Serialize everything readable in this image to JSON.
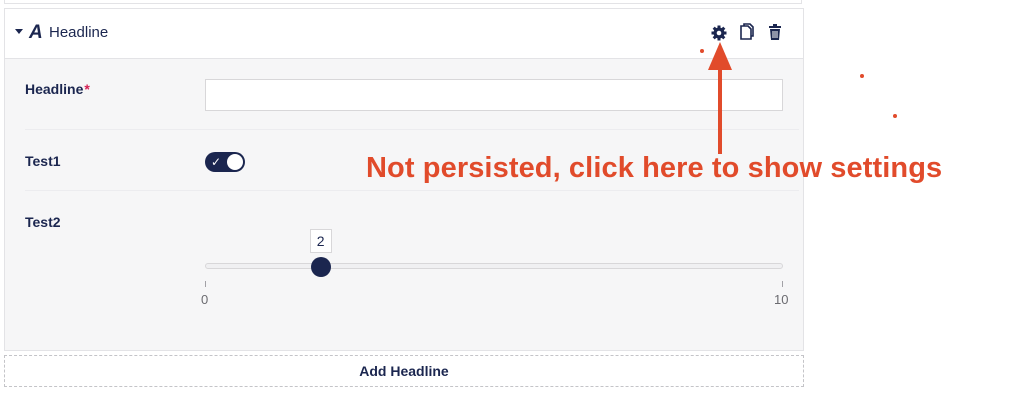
{
  "block": {
    "type_icon": "A",
    "title": "Headline",
    "actions": [
      {
        "name": "settings",
        "icon": "gear-icon"
      },
      {
        "name": "duplicate",
        "icon": "copy-icon"
      },
      {
        "name": "delete",
        "icon": "trash-icon"
      }
    ]
  },
  "fields": {
    "headline": {
      "label": "Headline",
      "required_mark": "*",
      "value": "",
      "placeholder": ""
    },
    "test1": {
      "label": "Test1",
      "checked": true,
      "check_glyph": "✓"
    },
    "test2": {
      "label": "Test2",
      "value": 2,
      "value_text": "2",
      "min": 0,
      "max": 10,
      "min_label": "0",
      "max_label": "10"
    }
  },
  "add_button": {
    "label": "Add Headline"
  },
  "annotation": {
    "text": "Not persisted, click here to show settings"
  },
  "colors": {
    "primary": "#1b264f",
    "annotation": "#e14b2b",
    "required": "#d42054"
  }
}
